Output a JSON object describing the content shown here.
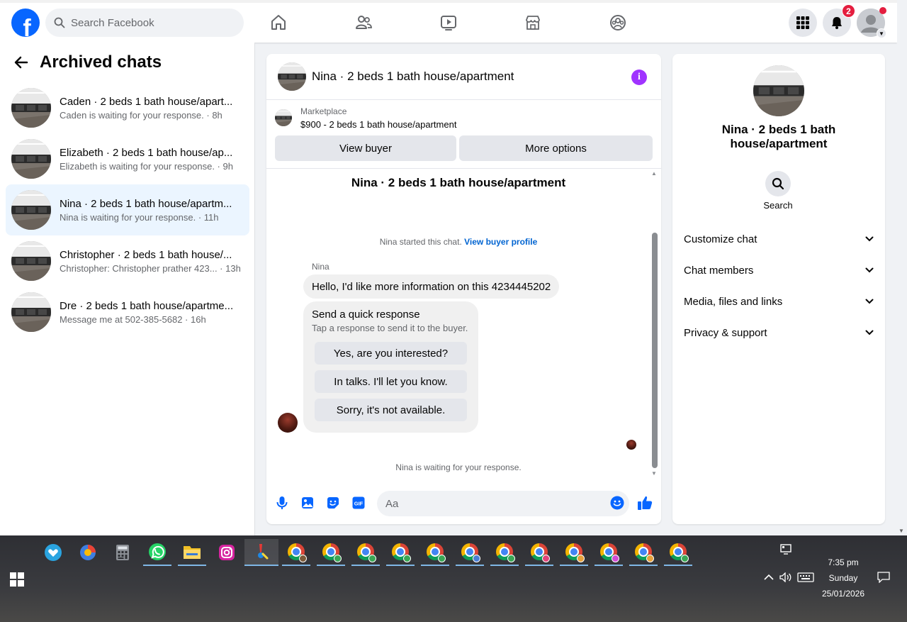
{
  "topbar": {
    "logo": "f",
    "search_placeholder": "Search Facebook",
    "notification_count": "2"
  },
  "left": {
    "title": "Archived chats",
    "chats": [
      {
        "title": "Caden · 2 beds 1 bath house/apart...",
        "sub": "Caden is waiting for your response. · 8h"
      },
      {
        "title": "Elizabeth · 2 beds 1 bath house/ap...",
        "sub": "Elizabeth is waiting for your response. · 9h"
      },
      {
        "title": "Nina · 2 beds 1 bath house/apartm...",
        "sub": "Nina is waiting for your response. · 11h"
      },
      {
        "title": "Christopher · 2 beds 1 bath house/...",
        "sub": "Christopher: Christopher prathe​r 423... · 13h"
      },
      {
        "title": "Dre · 2 beds 1 bath house/apartme...",
        "sub": "Message me at 502-385-5682 · 16h"
      }
    ]
  },
  "chat": {
    "title": "Nina · 2 beds 1 bath house/apartment",
    "market_label": "Marketplace",
    "market_price": "$900 - 2 beds 1 bath house/apartment",
    "view_buyer": "View buyer",
    "more_options": "More options",
    "body_title": "Nina · 2 beds 1 bath house/apartment",
    "started_text": "Nina started this chat.",
    "view_profile": "View buyer profile",
    "sender": "Nina",
    "message": "Hello, I'd like more information on this 4234445202",
    "quick_title": "Send a quick response",
    "quick_sub": "Tap a response to send it to the buyer.",
    "quick_replies": [
      "Yes, are you interested?",
      "In talks. I'll let you know.",
      "Sorry, it's not available."
    ],
    "waiting": "Nina is waiting for your response.",
    "input_placeholder": "Aa",
    "gif_label": "GIF"
  },
  "right": {
    "title": "Nina · 2 beds 1 bath house/apartment",
    "search_label": "Search",
    "sections": [
      "Customize chat",
      "Chat members",
      "Media, files and links",
      "Privacy & support"
    ]
  },
  "taskbar": {
    "time": "7:35 pm",
    "day": "Sunday",
    "date": "25/01/2026"
  },
  "colors": {
    "brand": "#0866ff",
    "accent_purple": "#a033ff",
    "active_row": "#ebf5ff",
    "badge_red": "#e41e3f"
  }
}
